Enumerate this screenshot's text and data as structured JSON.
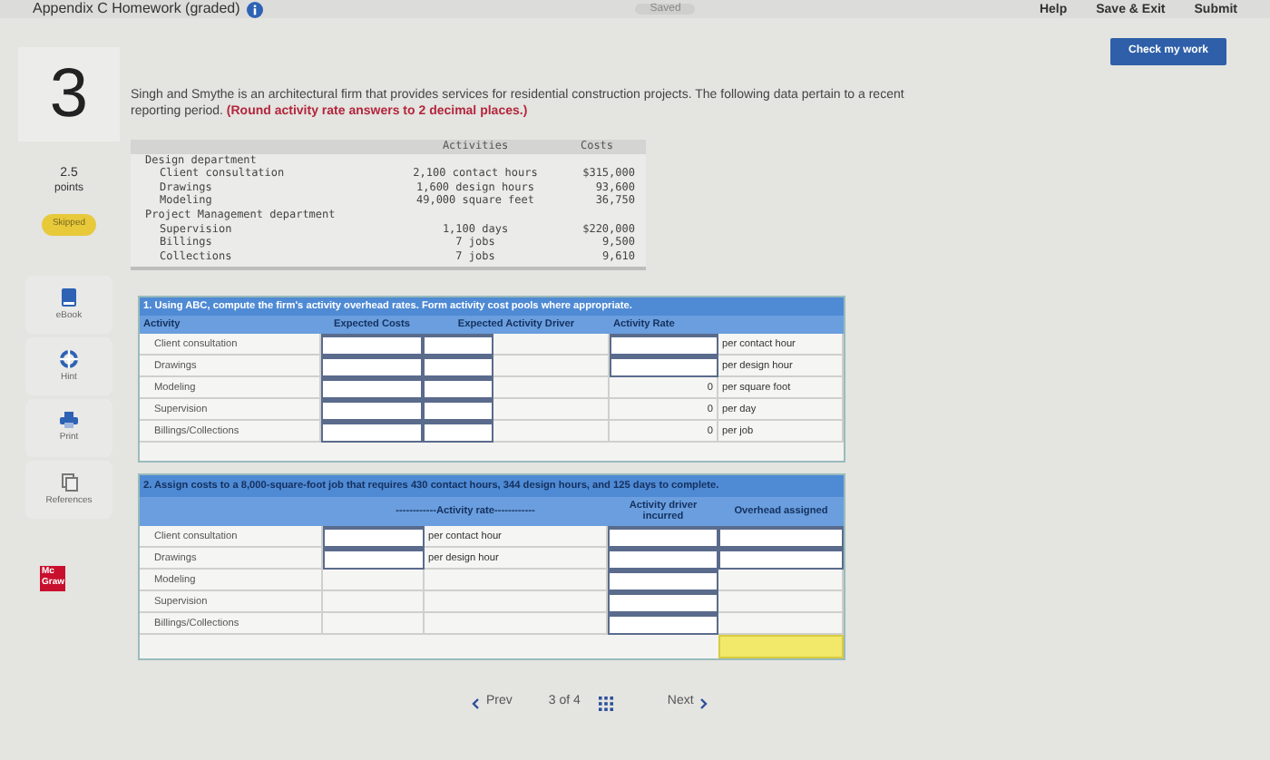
{
  "header": {
    "title": "Appendix C Homework (graded)",
    "saved": "Saved",
    "links": [
      "Help",
      "Save & Exit",
      "Submit"
    ]
  },
  "check_button": "Check my work",
  "question": {
    "number": "3",
    "points": "2.5",
    "points_label": "points",
    "status": "Skipped",
    "intro": "Singh and Smythe is an architectural firm that provides services for residential construction projects. The following data pertain to a recent reporting period. **(Round activity rate answers to 2 decimal places.)**"
  },
  "sidebar": [
    {
      "label": "eBook"
    },
    {
      "label": "Hint"
    },
    {
      "label": "Print"
    },
    {
      "label": "References"
    }
  ],
  "data_table": {
    "columns": [
      "Activities",
      "Costs"
    ],
    "rows": [
      {
        "kind": "group",
        "label": "Design department"
      },
      {
        "kind": "item",
        "label": "Client consultation",
        "activity": "2,100 contact hours",
        "cost": "$315,000"
      },
      {
        "kind": "item",
        "label": "Drawings",
        "activity": "1,600 design hours",
        "cost": "93,600"
      },
      {
        "kind": "item",
        "label": "Modeling",
        "activity": "49,000 square feet",
        "cost": "36,750"
      },
      {
        "kind": "group",
        "label": "Project Management department"
      },
      {
        "kind": "item",
        "label": "Supervision",
        "activity": "1,100 days",
        "cost": "$220,000"
      },
      {
        "kind": "item",
        "label": "Billings",
        "activity": "7 jobs",
        "cost": "9,500"
      },
      {
        "kind": "item",
        "label": "Collections",
        "activity": "7 jobs",
        "cost": "9,610"
      }
    ]
  },
  "part1": {
    "prompt": "1. Using ABC, compute the firm's activity overhead rates. Form activity cost pools where appropriate.",
    "columns": [
      "Activity",
      "Expected Costs",
      "Expected Activity Driver",
      "Activity Rate"
    ],
    "rows": [
      {
        "kind": "input",
        "label": "Client consultation",
        "unit": "per contact hour"
      },
      {
        "kind": "input",
        "label": "Drawings",
        "unit": "per design hour"
      },
      {
        "kind": "computed",
        "label": "Modeling",
        "rate": "0",
        "unit": "per square foot"
      },
      {
        "kind": "computed",
        "label": "Supervision",
        "rate": "0",
        "unit": "per day"
      },
      {
        "kind": "computed",
        "label": "Billings/Collections",
        "rate": "0",
        "unit": "per job"
      }
    ]
  },
  "part2": {
    "prompt": "2. Assign costs to a 8,000-square-foot job that requires 430 contact hours, 344 design hours, and 125 days to complete.",
    "columns": [
      "------------Activity rate------------",
      "Activity driver incurred",
      "Overhead assigned"
    ],
    "rows": [
      {
        "kind": "input",
        "label": "Client consultation",
        "unit": "per contact hour"
      },
      {
        "kind": "input",
        "label": "Drawings",
        "unit": "per design hour"
      },
      {
        "kind": "plain",
        "label": "Modeling"
      },
      {
        "kind": "plain",
        "label": "Supervision"
      },
      {
        "kind": "plain",
        "label": "Billings/Collections"
      }
    ]
  },
  "footer": {
    "logo": "Mc Graw",
    "prev": "Prev",
    "page": "3 of 4",
    "next": "Next"
  }
}
